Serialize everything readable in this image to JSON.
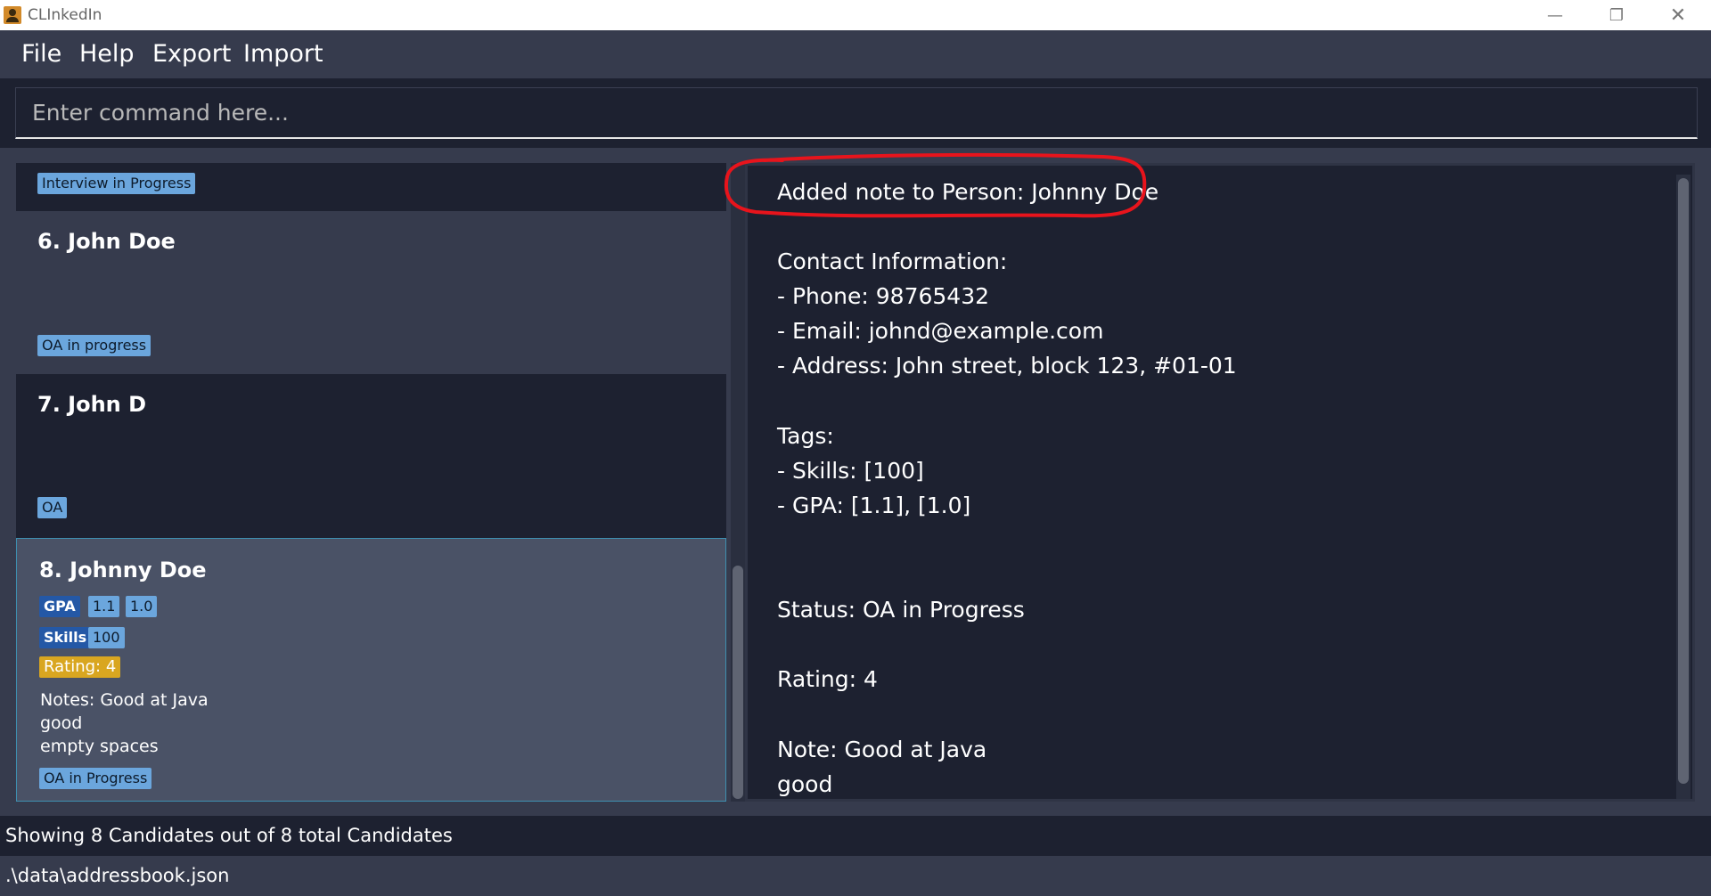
{
  "window": {
    "title": "CLInkedIn",
    "minimize_glyph": "—",
    "maximize_glyph": "❐",
    "close_glyph": "✕"
  },
  "menu": {
    "file": "File",
    "help": "Help",
    "export": "Export",
    "import": "Import"
  },
  "command": {
    "placeholder": "Enter command here..."
  },
  "list": {
    "partial_card": {
      "status": "Interview in Progress"
    },
    "cards": [
      {
        "title": "6.  John Doe",
        "status": "OA in progress"
      },
      {
        "title": "7.  John D",
        "status": "OA"
      },
      {
        "title": "8.  Johnny Doe",
        "gpa_label": "GPA",
        "gpa_values": [
          "1.1",
          "1.0"
        ],
        "skills_label": "Skills",
        "skills_values": [
          "100"
        ],
        "rating": "Rating: 4",
        "notes": [
          "Notes: Good at Java",
          "good",
          "empty spaces"
        ],
        "status": "OA in Progress"
      }
    ]
  },
  "result": {
    "text": "Added note to Person: Johnny Doe\n\nContact Information:\n- Phone: 98765432\n- Email: johnd@example.com\n- Address: John street, block 123, #01-01\n\nTags:\n- Skills: [100]\n- GPA: [1.1], [1.0]\n\n\nStatus: OA in Progress\n\nRating: 4\n\nNote: Good at Java\ngood"
  },
  "status_bar": {
    "count_text": "Showing  8  Candidates out of  8  total Candidates",
    "file_path": ".\\data\\addressbook.json"
  },
  "colors": {
    "annotation": "#e8141c",
    "tag_light": "#6ba6dd",
    "tag_dark": "#2458a6",
    "rating": "#d9a620"
  }
}
